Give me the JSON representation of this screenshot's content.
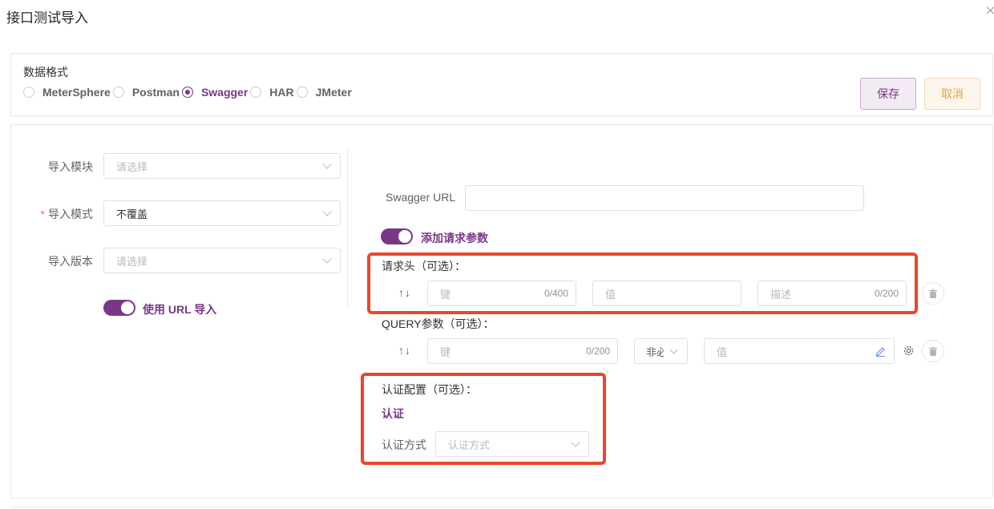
{
  "dialog": {
    "title": "接口测试导入"
  },
  "format": {
    "label": "数据格式",
    "options": [
      "MeterSphere",
      "Postman",
      "Swagger",
      "HAR",
      "JMeter"
    ],
    "selected": "Swagger"
  },
  "buttons": {
    "save": "保存",
    "cancel": "取消"
  },
  "form": {
    "module": {
      "label": "导入模块",
      "placeholder": "请选择"
    },
    "mode": {
      "label": "导入模式",
      "value": "不覆盖",
      "required_mark": "*"
    },
    "version": {
      "label": "导入版本",
      "placeholder": "请选择"
    },
    "use_url": {
      "label": "使用 URL 导入",
      "on": true
    }
  },
  "swagger": {
    "url_label": "Swagger URL",
    "url_value": "",
    "add_params": {
      "label": "添加请求参数",
      "on": true
    }
  },
  "headers": {
    "label": "请求头（可选）：",
    "sort_icon": "↑↓",
    "key_placeholder": "键",
    "key_count": "0/400",
    "value_placeholder": "值",
    "desc_placeholder": "描述",
    "desc_count": "0/200"
  },
  "query": {
    "label": "QUERY参数（可选）：",
    "sort_icon": "↑↓",
    "key_placeholder": "键",
    "key_count": "0/200",
    "required_select": "非必",
    "value_placeholder": "值"
  },
  "auth": {
    "label": "认证配置（可选）：",
    "title": "认证",
    "method_label": "认证方式",
    "method_placeholder": "认证方式"
  },
  "colors": {
    "accent": "#783887",
    "highlight_box": "#e8472a",
    "cancel": "#e6a23c"
  }
}
